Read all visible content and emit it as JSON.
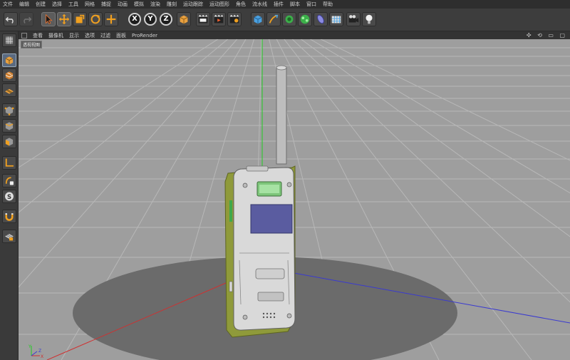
{
  "menu": [
    "文件",
    "编辑",
    "创建",
    "选择",
    "工具",
    "网格",
    "捕捉",
    "动画",
    "模拟",
    "渲染",
    "雕刻",
    "运动跟踪",
    "运动图形",
    "角色",
    "流水线",
    "插件",
    "脚本",
    "窗口",
    "帮助"
  ],
  "toolbar": {
    "axes": [
      "X",
      "Y",
      "Z"
    ],
    "tools": [
      "undo-icon",
      "redo-icon",
      "select-arrow-icon",
      "move-icon",
      "scale-icon",
      "rotate-icon",
      "recent-tool-icon",
      "coordinate-system-icon",
      "render-view-icon",
      "render-picture-icon",
      "render-settings-icon",
      "cube-icon",
      "pen-icon",
      "subdivision-icon",
      "array-icon",
      "deformer-icon",
      "floor-icon",
      "camera-icon",
      "light-icon"
    ]
  },
  "viewbar": {
    "items": [
      "查看",
      "摄像机",
      "显示",
      "选项",
      "过滤",
      "面板",
      "ProRender"
    ],
    "navicons": "✣ ⟲ ▭ ▢"
  },
  "viewport": {
    "label": "透视视图",
    "axis_gizmo": {
      "y": "Y",
      "x": "X",
      "z": "Z"
    }
  },
  "sidebar": [
    "make-editable-icon",
    "model-mode-icon",
    "texture-mode-icon",
    "workplane-icon",
    "points-mode-icon",
    "edges-mode-icon",
    "polygons-mode-icon",
    "axis-mode-icon",
    "tweak-icon",
    "snap-icon",
    "magnet-icon",
    "locked-workplane-icon"
  ],
  "colors": {
    "grid_floor": "#9e9e9e",
    "gridlines": "#b7b7b7",
    "shadow_disc": "#6b6b6b",
    "device_body": "#d9d9d9",
    "device_frame": "#8f9a3a",
    "screen_panel": "#5a5ca0",
    "display": "#7dc57a",
    "y_axis": "#22cc22",
    "x_axis": "#d03030",
    "z_axis": "#3a3ad0"
  }
}
